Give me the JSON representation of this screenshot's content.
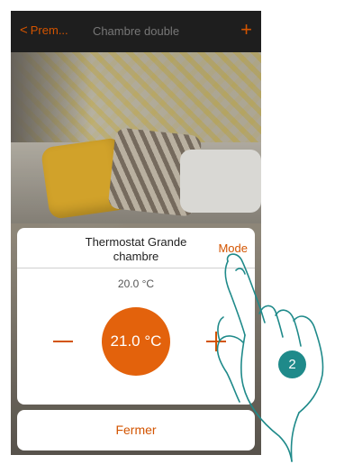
{
  "navbar": {
    "back_label": "Prem...",
    "title": "Chambre double",
    "add_label": "+"
  },
  "dialog": {
    "title": "Thermostat Grande chambre",
    "mode_label": "Mode",
    "setpoint": "20.0 °C",
    "current_temperature": "21.0 °C",
    "minus_label": "decrease",
    "plus_label": "increase"
  },
  "close_label": "Fermer",
  "step_number": "2",
  "colors": {
    "accent": "#d35400",
    "circle": "#e3620c",
    "badge": "#1f8a8a"
  }
}
